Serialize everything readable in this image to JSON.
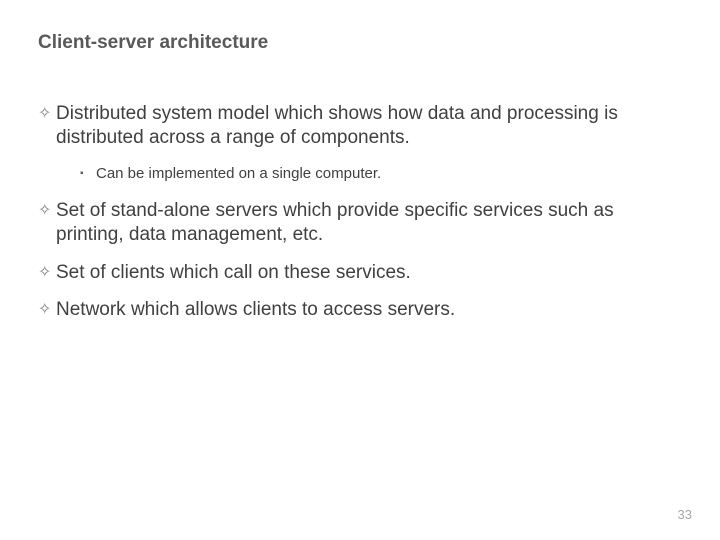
{
  "slide": {
    "title": "Client-server architecture",
    "bullets": [
      {
        "text": "Distributed system model which shows how data and processing is distributed across a range of components.",
        "sub": [
          {
            "text": "Can be implemented on a single computer."
          }
        ]
      },
      {
        "text": "Set of stand-alone servers which provide specific services such as printing, data management, etc."
      },
      {
        "text": "Set of clients which call on these services."
      },
      {
        "text": "Network which allows clients to access servers."
      }
    ],
    "page_number": "33"
  },
  "icons": {
    "diamond": "✧",
    "square": "▪"
  }
}
